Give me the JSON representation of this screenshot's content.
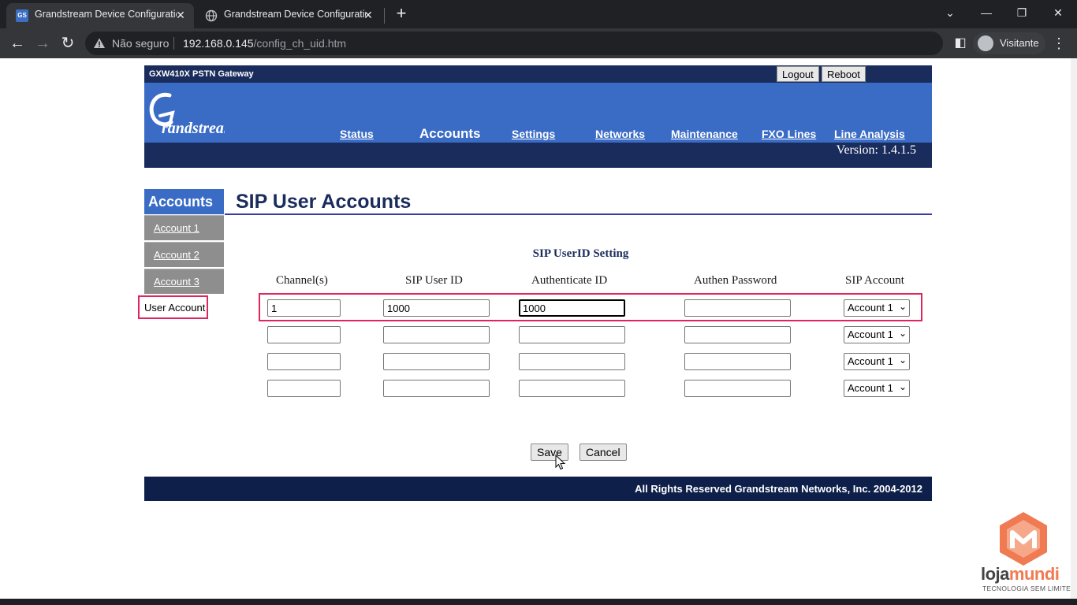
{
  "browser": {
    "tabs": [
      {
        "title": "Grandstream Device Configuratio",
        "active": true,
        "favicon": "GS"
      },
      {
        "title": "Grandstream Device Configuratio",
        "active": false,
        "favicon": "globe-icon"
      }
    ],
    "security_label": "Não seguro",
    "url_host": "192.168.0.145",
    "url_path": "/config_ch_uid.htm",
    "profile_name": "Visitante"
  },
  "header": {
    "model": "GXW410X PSTN Gateway",
    "logout_label": "Logout",
    "reboot_label": "Reboot",
    "nav": [
      {
        "label": "Status"
      },
      {
        "label": "Accounts"
      },
      {
        "label": "Settings"
      },
      {
        "label": "Networks"
      },
      {
        "label": "Maintenance"
      },
      {
        "label": "FXO Lines"
      },
      {
        "label": "Line Analysis"
      }
    ],
    "version": "Version: 1.4.1.5"
  },
  "sidebar": {
    "heading": "Accounts",
    "items": [
      {
        "label": "Account 1"
      },
      {
        "label": "Account 2"
      },
      {
        "label": "Account 3"
      }
    ],
    "active_label": "User Account"
  },
  "main": {
    "title": "SIP User Accounts",
    "section_title": "SIP UserID Setting",
    "columns": [
      "Channel(s)",
      "SIP User ID",
      "Authenticate ID",
      "Authen Password",
      "SIP Account"
    ],
    "rows": [
      {
        "channel": "1",
        "sip_user_id": "1000",
        "auth_id": "1000",
        "password": "",
        "account": "Account 1"
      },
      {
        "channel": "",
        "sip_user_id": "",
        "auth_id": "",
        "password": "",
        "account": "Account 1"
      },
      {
        "channel": "",
        "sip_user_id": "",
        "auth_id": "",
        "password": "",
        "account": "Account 1"
      },
      {
        "channel": "",
        "sip_user_id": "",
        "auth_id": "",
        "password": "",
        "account": "Account 1"
      }
    ],
    "save_label": "Save",
    "cancel_label": "Cancel"
  },
  "footer": {
    "text": "All Rights Reserved Grandstream Networks, Inc. 2004-2012"
  },
  "watermark": {
    "brand_a": "loja",
    "brand_b": "mundi",
    "tagline": "TECNOLOGIA SEM LIMITES",
    "accent": "#f07a52"
  },
  "colors": {
    "header_dark": "#1a2c5c",
    "header_blue": "#3a6cc6",
    "highlight": "#e0245e"
  }
}
